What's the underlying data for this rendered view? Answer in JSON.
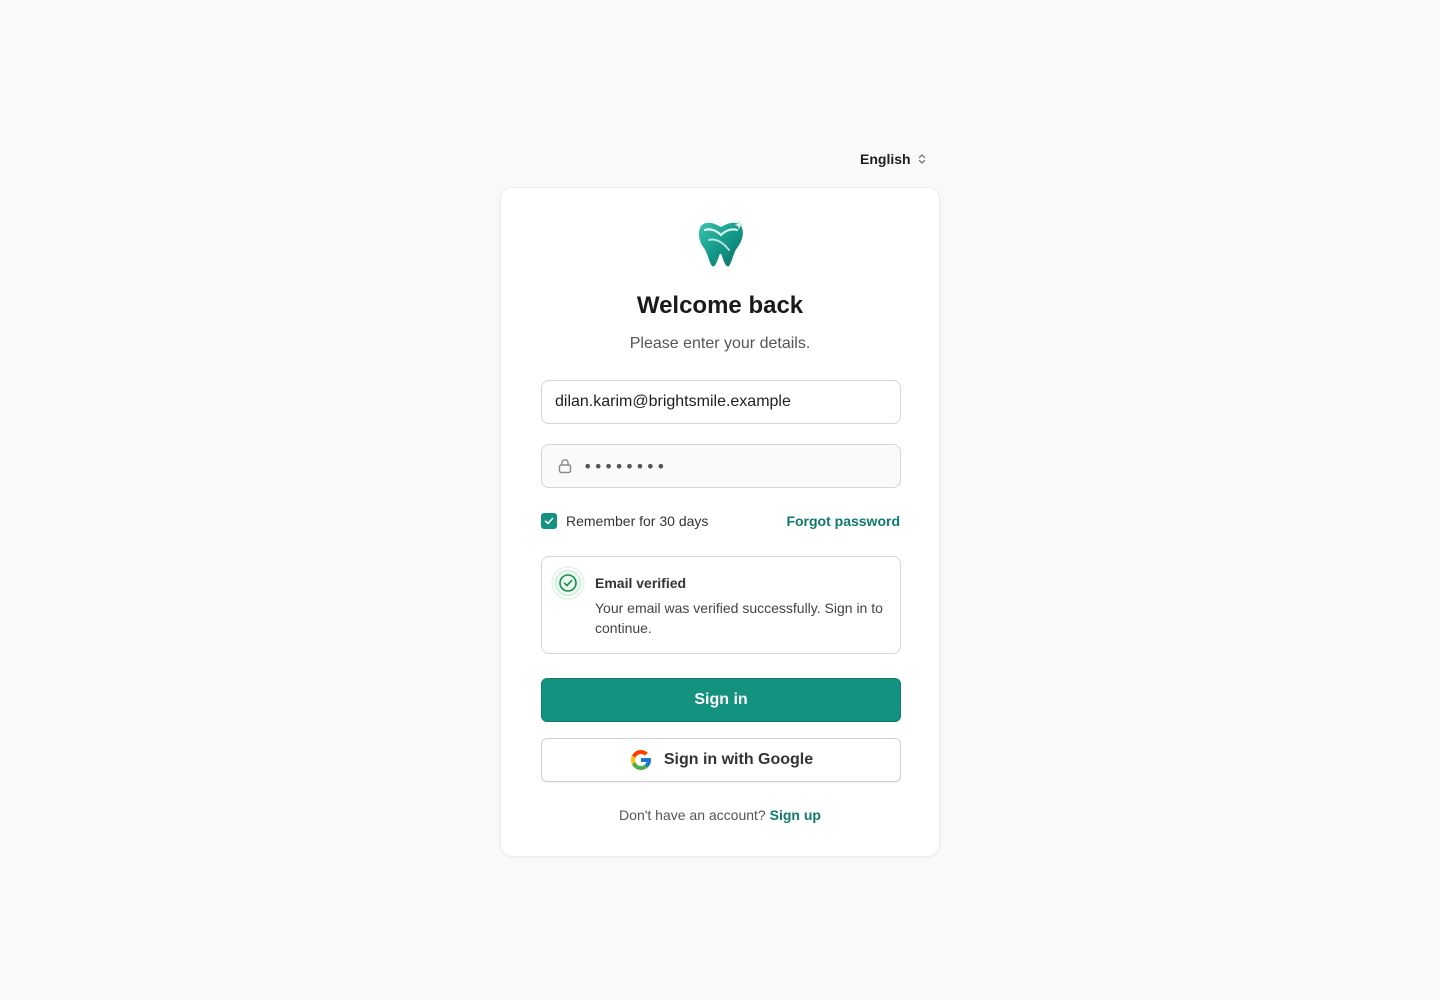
{
  "language": {
    "label": "English",
    "icon": "chevron-up-down-icon"
  },
  "brand": {
    "logo_icon": "tooth-logo-icon",
    "accent_color": "#12927f"
  },
  "header": {
    "title": "Welcome back",
    "subtitle": "Please enter your details."
  },
  "form": {
    "email": {
      "value": "dilan.karim@brightsmile.example",
      "placeholder": ""
    },
    "password": {
      "value": "••••••••",
      "icon": "lock-icon"
    },
    "remember": {
      "label": "Remember for 30 days",
      "checked": true
    },
    "forgot_label": "Forgot password"
  },
  "alert": {
    "icon": "check-circle-icon",
    "title": "Email verified",
    "message": "Your email was verified successfully. Sign in to continue."
  },
  "actions": {
    "sign_in_label": "Sign in",
    "google_label": "Sign in with Google",
    "google_icon": "google-icon"
  },
  "footer": {
    "prompt": "Don't have an account?",
    "signup_label": "Sign up"
  }
}
